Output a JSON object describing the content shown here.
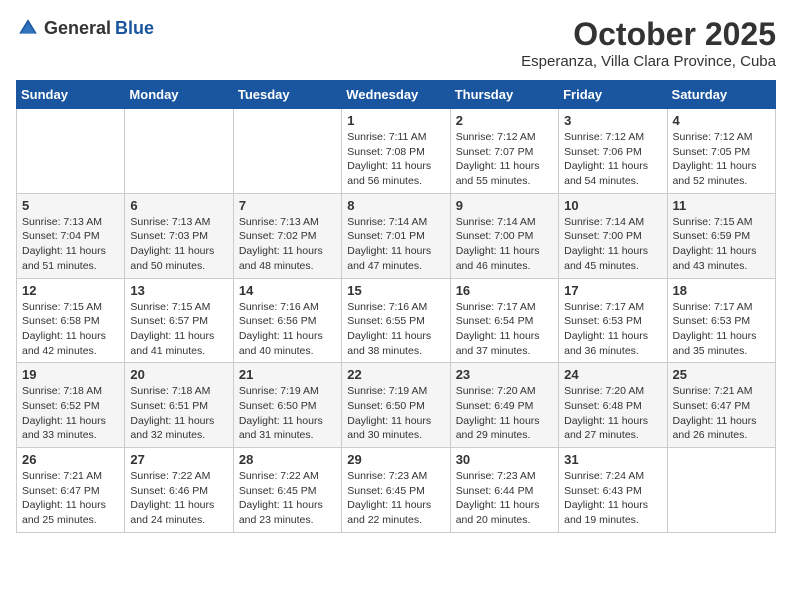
{
  "header": {
    "logo_general": "General",
    "logo_blue": "Blue",
    "month": "October 2025",
    "location": "Esperanza, Villa Clara Province, Cuba"
  },
  "weekdays": [
    "Sunday",
    "Monday",
    "Tuesday",
    "Wednesday",
    "Thursday",
    "Friday",
    "Saturday"
  ],
  "weeks": [
    [
      {
        "day": "",
        "sunrise": "",
        "sunset": "",
        "daylight": ""
      },
      {
        "day": "",
        "sunrise": "",
        "sunset": "",
        "daylight": ""
      },
      {
        "day": "",
        "sunrise": "",
        "sunset": "",
        "daylight": ""
      },
      {
        "day": "1",
        "sunrise": "Sunrise: 7:11 AM",
        "sunset": "Sunset: 7:08 PM",
        "daylight": "Daylight: 11 hours and 56 minutes."
      },
      {
        "day": "2",
        "sunrise": "Sunrise: 7:12 AM",
        "sunset": "Sunset: 7:07 PM",
        "daylight": "Daylight: 11 hours and 55 minutes."
      },
      {
        "day": "3",
        "sunrise": "Sunrise: 7:12 AM",
        "sunset": "Sunset: 7:06 PM",
        "daylight": "Daylight: 11 hours and 54 minutes."
      },
      {
        "day": "4",
        "sunrise": "Sunrise: 7:12 AM",
        "sunset": "Sunset: 7:05 PM",
        "daylight": "Daylight: 11 hours and 52 minutes."
      }
    ],
    [
      {
        "day": "5",
        "sunrise": "Sunrise: 7:13 AM",
        "sunset": "Sunset: 7:04 PM",
        "daylight": "Daylight: 11 hours and 51 minutes."
      },
      {
        "day": "6",
        "sunrise": "Sunrise: 7:13 AM",
        "sunset": "Sunset: 7:03 PM",
        "daylight": "Daylight: 11 hours and 50 minutes."
      },
      {
        "day": "7",
        "sunrise": "Sunrise: 7:13 AM",
        "sunset": "Sunset: 7:02 PM",
        "daylight": "Daylight: 11 hours and 48 minutes."
      },
      {
        "day": "8",
        "sunrise": "Sunrise: 7:14 AM",
        "sunset": "Sunset: 7:01 PM",
        "daylight": "Daylight: 11 hours and 47 minutes."
      },
      {
        "day": "9",
        "sunrise": "Sunrise: 7:14 AM",
        "sunset": "Sunset: 7:00 PM",
        "daylight": "Daylight: 11 hours and 46 minutes."
      },
      {
        "day": "10",
        "sunrise": "Sunrise: 7:14 AM",
        "sunset": "Sunset: 7:00 PM",
        "daylight": "Daylight: 11 hours and 45 minutes."
      },
      {
        "day": "11",
        "sunrise": "Sunrise: 7:15 AM",
        "sunset": "Sunset: 6:59 PM",
        "daylight": "Daylight: 11 hours and 43 minutes."
      }
    ],
    [
      {
        "day": "12",
        "sunrise": "Sunrise: 7:15 AM",
        "sunset": "Sunset: 6:58 PM",
        "daylight": "Daylight: 11 hours and 42 minutes."
      },
      {
        "day": "13",
        "sunrise": "Sunrise: 7:15 AM",
        "sunset": "Sunset: 6:57 PM",
        "daylight": "Daylight: 11 hours and 41 minutes."
      },
      {
        "day": "14",
        "sunrise": "Sunrise: 7:16 AM",
        "sunset": "Sunset: 6:56 PM",
        "daylight": "Daylight: 11 hours and 40 minutes."
      },
      {
        "day": "15",
        "sunrise": "Sunrise: 7:16 AM",
        "sunset": "Sunset: 6:55 PM",
        "daylight": "Daylight: 11 hours and 38 minutes."
      },
      {
        "day": "16",
        "sunrise": "Sunrise: 7:17 AM",
        "sunset": "Sunset: 6:54 PM",
        "daylight": "Daylight: 11 hours and 37 minutes."
      },
      {
        "day": "17",
        "sunrise": "Sunrise: 7:17 AM",
        "sunset": "Sunset: 6:53 PM",
        "daylight": "Daylight: 11 hours and 36 minutes."
      },
      {
        "day": "18",
        "sunrise": "Sunrise: 7:17 AM",
        "sunset": "Sunset: 6:53 PM",
        "daylight": "Daylight: 11 hours and 35 minutes."
      }
    ],
    [
      {
        "day": "19",
        "sunrise": "Sunrise: 7:18 AM",
        "sunset": "Sunset: 6:52 PM",
        "daylight": "Daylight: 11 hours and 33 minutes."
      },
      {
        "day": "20",
        "sunrise": "Sunrise: 7:18 AM",
        "sunset": "Sunset: 6:51 PM",
        "daylight": "Daylight: 11 hours and 32 minutes."
      },
      {
        "day": "21",
        "sunrise": "Sunrise: 7:19 AM",
        "sunset": "Sunset: 6:50 PM",
        "daylight": "Daylight: 11 hours and 31 minutes."
      },
      {
        "day": "22",
        "sunrise": "Sunrise: 7:19 AM",
        "sunset": "Sunset: 6:50 PM",
        "daylight": "Daylight: 11 hours and 30 minutes."
      },
      {
        "day": "23",
        "sunrise": "Sunrise: 7:20 AM",
        "sunset": "Sunset: 6:49 PM",
        "daylight": "Daylight: 11 hours and 29 minutes."
      },
      {
        "day": "24",
        "sunrise": "Sunrise: 7:20 AM",
        "sunset": "Sunset: 6:48 PM",
        "daylight": "Daylight: 11 hours and 27 minutes."
      },
      {
        "day": "25",
        "sunrise": "Sunrise: 7:21 AM",
        "sunset": "Sunset: 6:47 PM",
        "daylight": "Daylight: 11 hours and 26 minutes."
      }
    ],
    [
      {
        "day": "26",
        "sunrise": "Sunrise: 7:21 AM",
        "sunset": "Sunset: 6:47 PM",
        "daylight": "Daylight: 11 hours and 25 minutes."
      },
      {
        "day": "27",
        "sunrise": "Sunrise: 7:22 AM",
        "sunset": "Sunset: 6:46 PM",
        "daylight": "Daylight: 11 hours and 24 minutes."
      },
      {
        "day": "28",
        "sunrise": "Sunrise: 7:22 AM",
        "sunset": "Sunset: 6:45 PM",
        "daylight": "Daylight: 11 hours and 23 minutes."
      },
      {
        "day": "29",
        "sunrise": "Sunrise: 7:23 AM",
        "sunset": "Sunset: 6:45 PM",
        "daylight": "Daylight: 11 hours and 22 minutes."
      },
      {
        "day": "30",
        "sunrise": "Sunrise: 7:23 AM",
        "sunset": "Sunset: 6:44 PM",
        "daylight": "Daylight: 11 hours and 20 minutes."
      },
      {
        "day": "31",
        "sunrise": "Sunrise: 7:24 AM",
        "sunset": "Sunset: 6:43 PM",
        "daylight": "Daylight: 11 hours and 19 minutes."
      },
      {
        "day": "",
        "sunrise": "",
        "sunset": "",
        "daylight": ""
      }
    ]
  ]
}
